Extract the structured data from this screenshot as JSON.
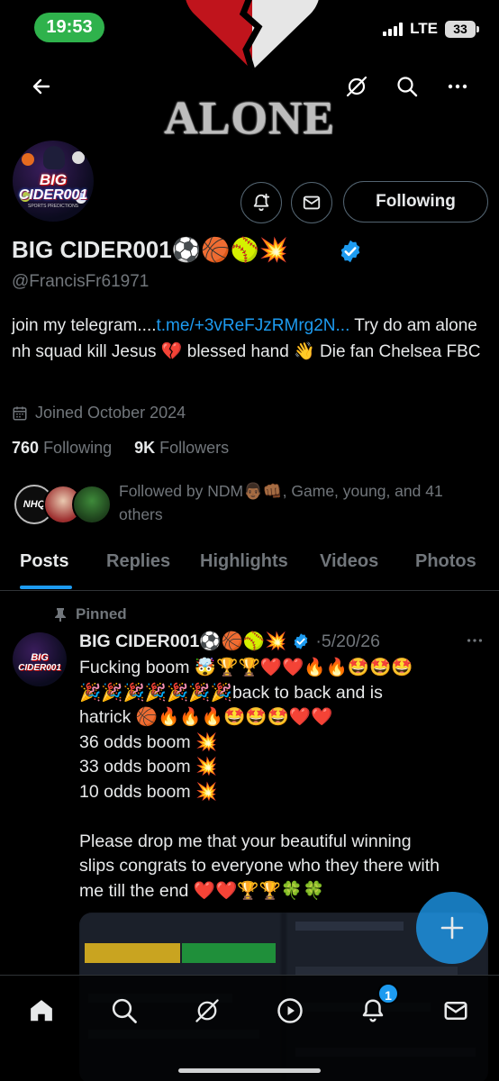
{
  "status_bar": {
    "time": "19:53",
    "network": "LTE",
    "battery": "33"
  },
  "banner": {
    "text": "ALONE"
  },
  "profile": {
    "display_name": "BIG CIDER001",
    "name_emojis": "⚽🏀🥎💥",
    "handle": "@FrancisFr61971",
    "avatar_text_1": "BIG",
    "avatar_text_2": "CIDER001",
    "avatar_text_3": "SPORTS PREDICTIONS",
    "bio_prefix": "join my telegram....",
    "bio_link": "t.me/+3vReFJzRMrg2N...",
    "bio_suffix": " Try do am alone nh squad kill Jesus 💔 blessed hand 👋 Die fan Chelsea FBC",
    "joined": "Joined October 2024",
    "following_count": "760",
    "following_label": "Following",
    "followers_count": "9K",
    "followers_label": "Followers",
    "followed_by": "Followed by NDM👨🏾👊🏾, Game, young, and 41 others",
    "follow_button_label": "Following",
    "follower_avatar_1_text": "NHQ"
  },
  "tabs": [
    {
      "label": "Posts",
      "active": true
    },
    {
      "label": "Replies",
      "active": false
    },
    {
      "label": "Highlights",
      "active": false
    },
    {
      "label": "Videos",
      "active": false
    },
    {
      "label": "Photos",
      "active": false
    }
  ],
  "pinned_post": {
    "pinned_label": "Pinned",
    "author": "BIG CIDER001⚽🏀🥎💥",
    "date": "·5/20/26",
    "lines": [
      "Fucking boom 🤯🏆🏆❤️❤️🔥🔥🤩🤩🤩",
      "🎉🎉🎉🎉🎉🎉🎉back to back and is",
      "hatrick 🏀🔥🔥🔥🤩🤩🤩❤️❤️",
      "36 odds boom 💥",
      "33 odds boom 💥",
      "10 odds boom 💥",
      "",
      "Please drop me that your beautiful winning",
      "slips congrats to everyone who they there with",
      "me till the end ❤️❤️🏆🏆🍀🍀"
    ],
    "avatar_text_1": "BIG",
    "avatar_text_2": "CIDER001"
  },
  "bottom_nav": {
    "items": [
      "home",
      "search",
      "grok",
      "video",
      "notifications",
      "messages"
    ],
    "notification_count": "1"
  },
  "colors": {
    "accent": "#1d9bf0",
    "background": "#000000",
    "primary_text": "#e7e9ea",
    "secondary_text": "#71767b",
    "status_pill": "#2fb24c",
    "border": "#2f3336"
  }
}
